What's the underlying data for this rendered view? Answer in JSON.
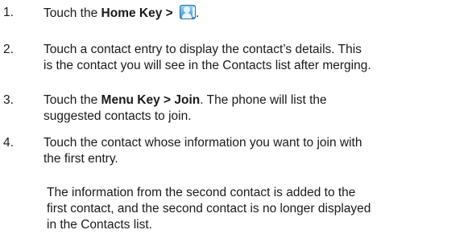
{
  "steps": [
    {
      "number": "1.",
      "text_before": "Touch the ",
      "bold": "Home Key >",
      "icon": "contacts-app-icon",
      "text_after": "."
    },
    {
      "number": "2.",
      "line1": "Touch a contact entry to display the contact’s details. This",
      "line2": "is the contact you will see in the Contacts list after merging."
    },
    {
      "number": "3.",
      "text_before": "Touch the ",
      "bold": "Menu Key > Join",
      "text_after": ". The phone will list the",
      "line2": "suggested contacts to join."
    },
    {
      "number": "4.",
      "line1": "Touch the contact whose information you want to join with",
      "line2": "the first entry."
    }
  ],
  "note": {
    "line1": "The information from the second contact is added to the",
    "line2": "first contact, and the second contact is no longer displayed",
    "line3": "in the Contacts list."
  }
}
